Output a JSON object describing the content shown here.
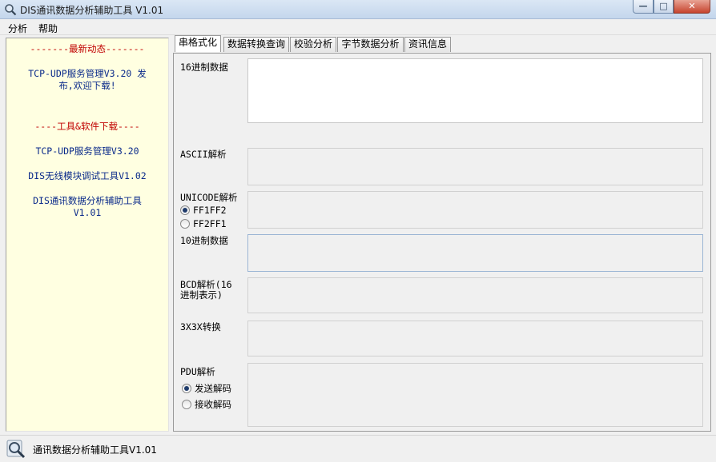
{
  "window": {
    "title": "DIS通讯数据分析辅助工具 V1.01",
    "controls": {
      "minimize": "—",
      "maximize": "□",
      "close": "✕"
    }
  },
  "menu": {
    "items": [
      "分析",
      "帮助"
    ]
  },
  "sidebar": {
    "news_header": "-------最新动态-------",
    "news_item": [
      "TCP-UDP服务管理V3.20 发",
      "布,欢迎下载!"
    ],
    "downloads_header": "----工具&软件下载----",
    "downloads": [
      [
        "TCP-UDP服务管理V3.20"
      ],
      [
        "DIS无线模块调试工具V1.02"
      ],
      [
        "DIS通讯数据分析辅助工具",
        "V1.01"
      ]
    ]
  },
  "tabs": [
    {
      "label": "串格式化",
      "active": true
    },
    {
      "label": "数据转换查询",
      "active": false
    },
    {
      "label": "校验分析",
      "active": false
    },
    {
      "label": "字节数据分析",
      "active": false
    },
    {
      "label": "资讯信息",
      "active": false
    }
  ],
  "fields": {
    "hex": {
      "label": "16进制数据",
      "value": ""
    },
    "ascii": {
      "label": "ASCII解析",
      "value": ""
    },
    "unicode": {
      "label": "UNICODE解析",
      "value": "",
      "options": [
        "FF1FF2",
        "FF2FF1"
      ],
      "selected": "FF1FF2"
    },
    "decimal": {
      "label": "10进制数据",
      "value": ""
    },
    "bcd": {
      "label": [
        "BCD解析(16",
        "进制表示)"
      ],
      "value": ""
    },
    "conv3x3x": {
      "label": "3X3X转换",
      "value": ""
    },
    "pdu": {
      "label": "PDU解析",
      "value": "",
      "options": [
        "发送解码",
        "接收解码"
      ],
      "selected": "发送解码"
    }
  },
  "status": {
    "text": "通讯数据分析辅助工具V1.01"
  },
  "icons": {
    "app": "magnifier-icon",
    "status": "magnifier-icon"
  }
}
